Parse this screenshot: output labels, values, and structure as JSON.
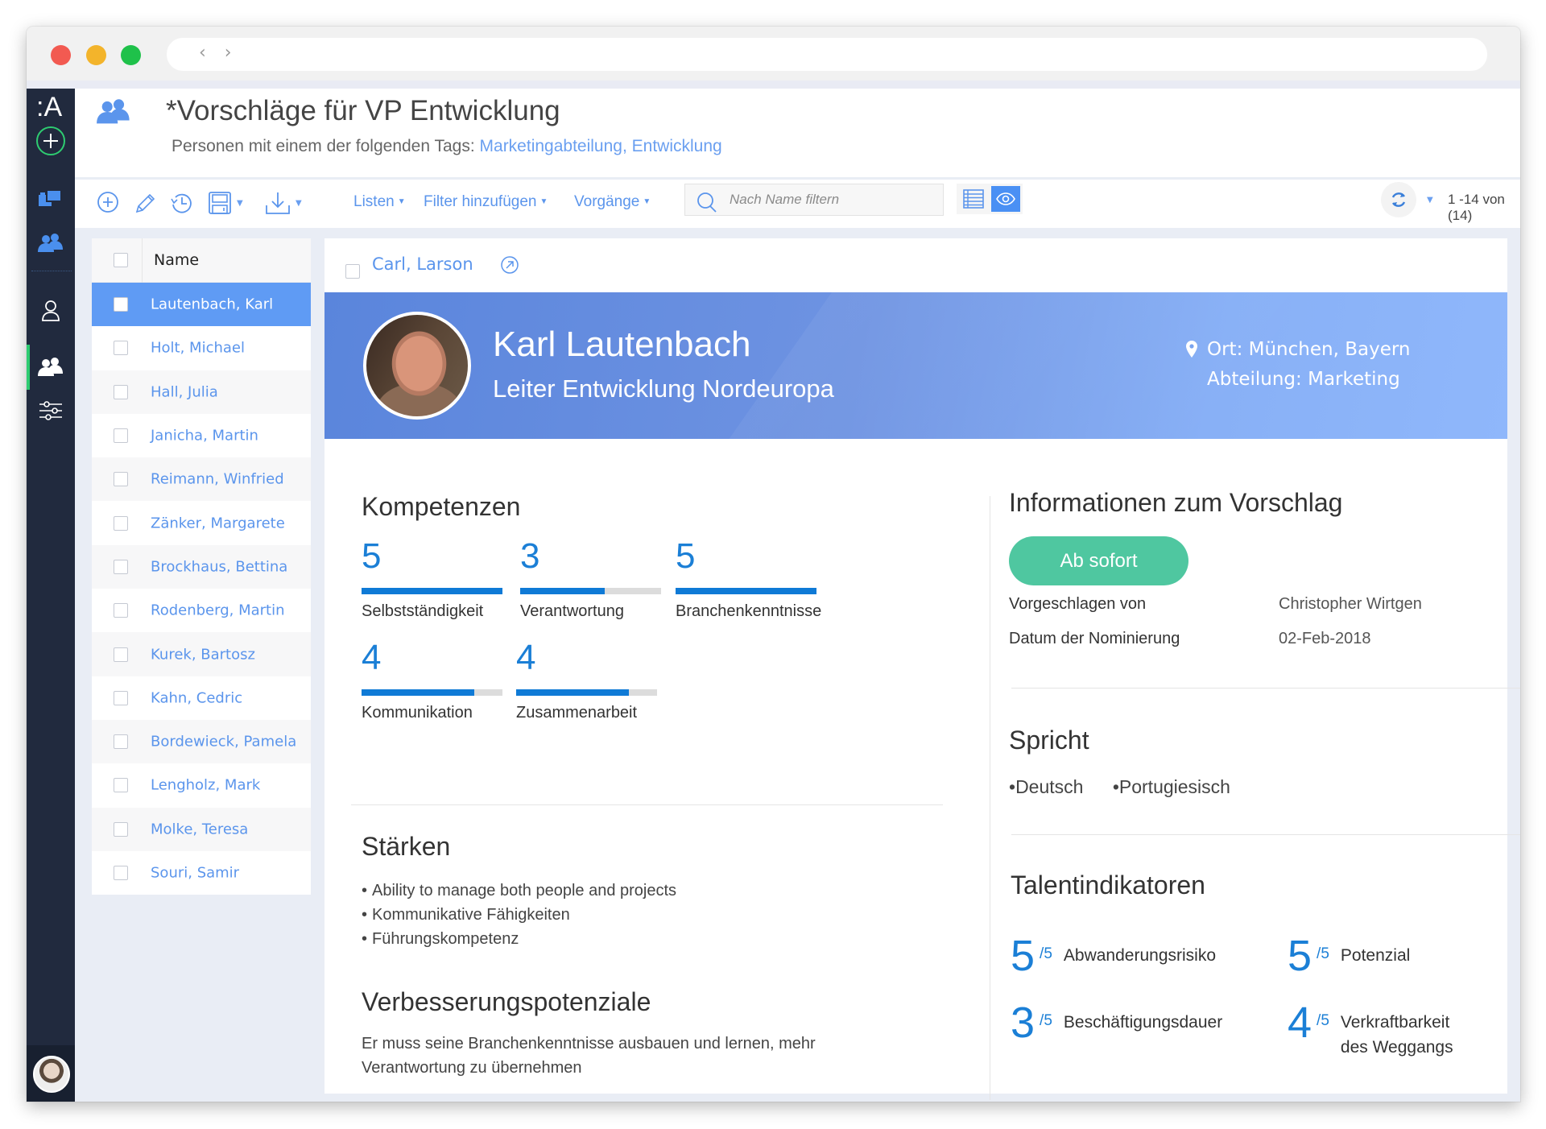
{
  "window": {
    "nav_arrows": "‹ ›"
  },
  "sidebar": {
    "logo": ":A",
    "items": [
      {
        "name": "add",
        "icon": "plus-circle-icon"
      },
      {
        "name": "folders",
        "icon": "folders-icon"
      },
      {
        "name": "groups",
        "icon": "people-icon"
      },
      {
        "name": "person",
        "icon": "person-icon"
      },
      {
        "name": "people",
        "icon": "people-icon",
        "active": true
      },
      {
        "name": "settings",
        "icon": "sliders-icon"
      }
    ],
    "accent": "#2ecc71"
  },
  "header": {
    "title": "*Vorschläge für VP Entwicklung",
    "subtitle_prefix": "Personen mit einem der folgenden Tags: ",
    "subtitle_tags": "Marketingabteilung, Entwicklung"
  },
  "toolbar": {
    "menus": [
      "Listen",
      "Filter hinzufügen",
      "Vorgänge"
    ],
    "search_placeholder": "Nach Name filtern",
    "pager": "1 -14 von (14)"
  },
  "list": {
    "column_header": "Name",
    "rows": [
      {
        "name": "Lautenbach, Karl",
        "selected": true
      },
      {
        "name": "Holt, Michael"
      },
      {
        "name": "Hall, Julia"
      },
      {
        "name": "Janicha, Martin"
      },
      {
        "name": "Reimann, Winfried"
      },
      {
        "name": "Zänker, Margarete"
      },
      {
        "name": "Brockhaus, Bettina"
      },
      {
        "name": "Rodenberg, Martin"
      },
      {
        "name": "Kurek, Bartosz"
      },
      {
        "name": "Kahn, Cedric"
      },
      {
        "name": "Bordewieck, Pamela"
      },
      {
        "name": "Lengholz, Mark"
      },
      {
        "name": "Molke, Teresa"
      },
      {
        "name": "Souri, Samir"
      }
    ]
  },
  "detail": {
    "top_link": "Carl, Larson",
    "profile": {
      "name": "Karl Lautenbach",
      "role": "Leiter Entwicklung Nordeuropa",
      "location": "Ort: München, Bayern",
      "department": "Abteilung: Marketing"
    },
    "competencies": {
      "title": "Kompetenzen",
      "max": 5,
      "items": [
        {
          "label": "Selbstständigkeit",
          "value": 5
        },
        {
          "label": "Verantwortung",
          "value": 3
        },
        {
          "label": "Branchenkenntnisse",
          "value": 5
        },
        {
          "label": "Kommunikation",
          "value": 4
        },
        {
          "label": "Zusammenarbeit",
          "value": 4
        }
      ]
    },
    "strengths": {
      "title": "Stärken",
      "items": [
        "Ability to manage both people and projects",
        "Kommunikative Fähigkeiten",
        "Führungskompetenz"
      ]
    },
    "improvements": {
      "title": "Verbesserungspotenziale",
      "text": "Er muss seine Branchenkenntnisse ausbauen und lernen, mehr Verantwortung zu übernehmen"
    },
    "proposal": {
      "title": "Informationen zum Vorschlag",
      "status": "Ab sofort",
      "status_color": "#4fc7a0",
      "proposed_by_label": "Vorgeschlagen von",
      "proposed_by": "Christopher Wirtgen",
      "date_label": "Datum der Nominierung",
      "date": "02-Feb-2018"
    },
    "languages": {
      "title": "Spricht",
      "items": [
        "Deutsch",
        "Portugiesisch"
      ]
    },
    "talent": {
      "title": "Talentindikatoren",
      "of_label": "/5",
      "items": [
        {
          "label": "Abwanderungsrisiko",
          "value": "5"
        },
        {
          "label": "Potenzial",
          "value": "5"
        },
        {
          "label": "Beschäftigungsdauer",
          "value": "3"
        },
        {
          "label": "Verkraftbarkeit des Weggangs",
          "value": "4"
        }
      ]
    }
  }
}
